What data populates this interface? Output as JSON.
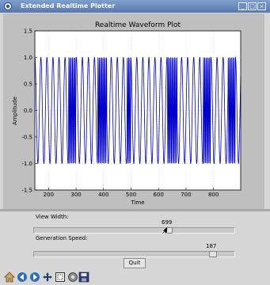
{
  "window": {
    "title": "Extended Realtime Plotter"
  },
  "chart_data": {
    "type": "line",
    "title": "Realtime Waveform Plot",
    "xlabel": "Time",
    "ylabel": "Amplitude",
    "xlim": [
      150,
      899
    ],
    "ylim": [
      -1.5,
      1.5
    ],
    "xticks": [
      "200",
      "300",
      "400",
      "500",
      "600",
      "700",
      "800"
    ],
    "yticks": [
      "1.5",
      "1.0",
      "0.5",
      "0.0",
      "-0.5",
      "-1.0",
      "-1.5"
    ],
    "grid": true,
    "series": [
      {
        "color": "#0000cc",
        "amplitude": 1.0,
        "period": 22,
        "dense_segments": [
          [
            272,
            300
          ],
          [
            378,
            412
          ],
          [
            485,
            500
          ],
          [
            632,
            668
          ],
          [
            762,
            790
          ],
          [
            853,
            880
          ]
        ]
      }
    ]
  },
  "controls": {
    "view_width_label": "View Width:",
    "view_width_value": "699",
    "view_width_fraction": 0.68,
    "generation_speed_label": "Generation Speed:",
    "generation_speed_value": "187",
    "generation_speed_fraction": 0.91,
    "quit_label": "Quit"
  },
  "toolbar": {
    "icons": [
      "home-icon",
      "back-icon",
      "forward-icon",
      "pan-icon",
      "zoom-icon",
      "configure-icon",
      "save-icon"
    ]
  },
  "colors": {
    "line": "#0000cc",
    "window": "#d6d6d6",
    "plot_frame": "#bfbfbf",
    "titlebar": "#5877ad"
  }
}
